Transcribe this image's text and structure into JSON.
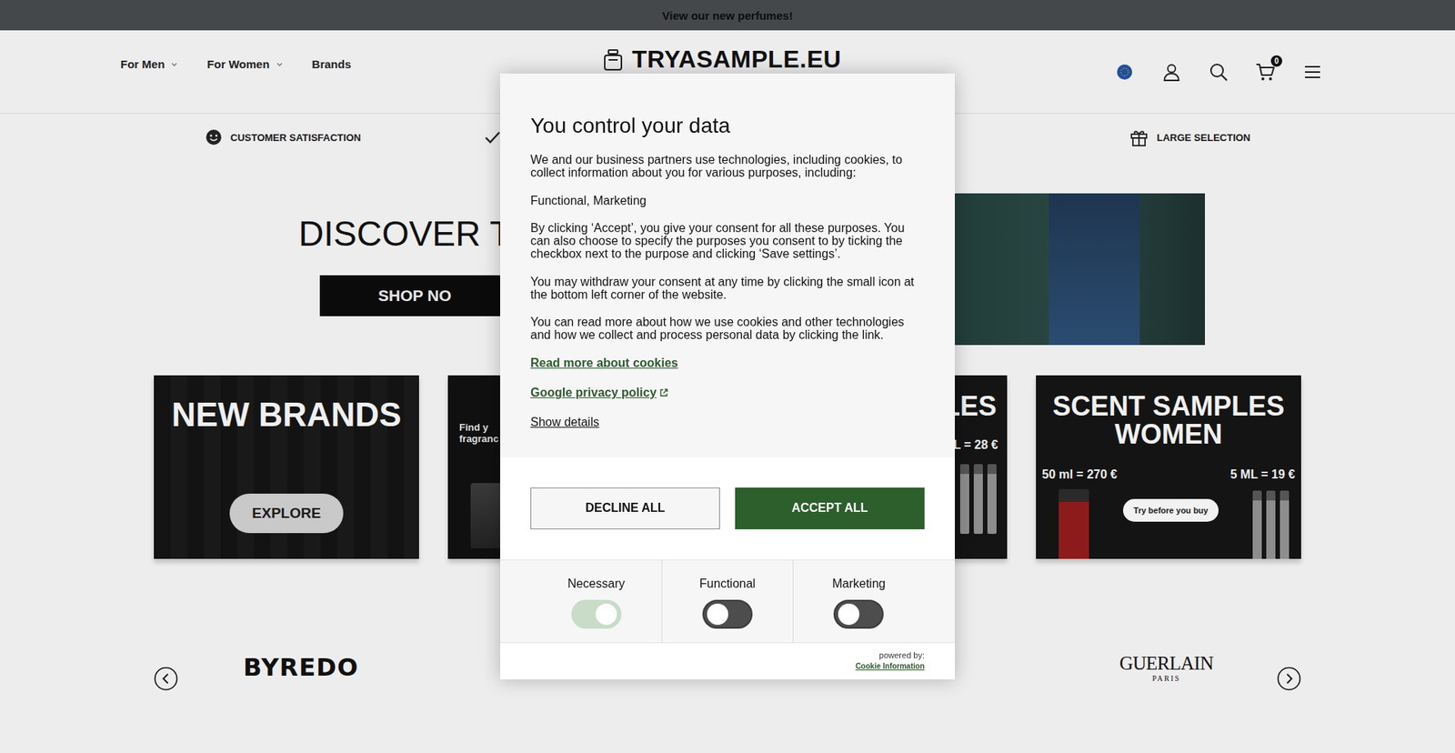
{
  "announcement": "View our new perfumes!",
  "nav": [
    {
      "label": "For Men",
      "has_menu": true
    },
    {
      "label": "For Women",
      "has_menu": true
    },
    {
      "label": "Brands",
      "has_menu": false
    }
  ],
  "logo": "TRYASAMPLE.EU",
  "cart": {
    "count": "0"
  },
  "usps": [
    {
      "kind": "rating",
      "title": "CUSTOMER SATISFACTION"
    },
    {
      "kind": "quality"
    },
    {
      "kind": "selection",
      "title": "LARGE SELECTION"
    }
  ],
  "hero": {
    "headline": "DISCOVER TO",
    "button": "SHOP NO"
  },
  "cards": [
    {
      "kind": "brands",
      "title": "NEW BRANDS",
      "button": "EXPLORE"
    },
    {
      "kind": "finder",
      "lines": [
        "Find y",
        "fragranc"
      ]
    },
    {
      "kind": "men",
      "title": "LES",
      "price": "L = 28 €"
    },
    {
      "kind": "women",
      "title": "SCENT SAMPLES WOMEN",
      "price_left": "50 ml = 270 €",
      "price_right": "5 ML = 19 €",
      "button": "Try before you buy"
    }
  ],
  "brands": [
    {
      "kind": "sans",
      "name": "BYREDO"
    },
    {
      "kind": "serif",
      "name": "GUERLAIN",
      "sub": "PARIS"
    }
  ],
  "consent": {
    "title": "You control your data",
    "paragraphs": [
      "We and our business partners use technologies, including cookies, to collect information about you for various purposes, including:",
      "Functional, Marketing",
      "By clicking ‘Accept’, you give your consent for all these purposes. You can also choose to specify the purposes you consent to by ticking the checkbox next to the purpose and clicking ‘Save settings’.",
      "You may withdraw your consent at any time by clicking the small icon at the bottom left corner of the website.",
      "You can read more about how we use cookies and other technologies and how we collect and process personal data by clicking the link."
    ],
    "links": [
      {
        "label": "Read more about cookies",
        "kind": "bold",
        "external": false
      },
      {
        "label": "Google privacy policy",
        "kind": "bold",
        "external": true
      },
      {
        "label": "Show details",
        "kind": "plain",
        "external": false
      }
    ],
    "buttons": [
      {
        "label": "DECLINE ALL",
        "kind": "secondary"
      },
      {
        "label": "ACCEPT ALL",
        "kind": "primary"
      }
    ],
    "categories": [
      {
        "label": "Necessary",
        "on": true,
        "disabled": true
      },
      {
        "label": "Functional",
        "on": false,
        "disabled": false
      },
      {
        "label": "Marketing",
        "on": false,
        "disabled": false
      }
    ],
    "powered_by": "powered by:",
    "provider": "Cookie Information"
  }
}
